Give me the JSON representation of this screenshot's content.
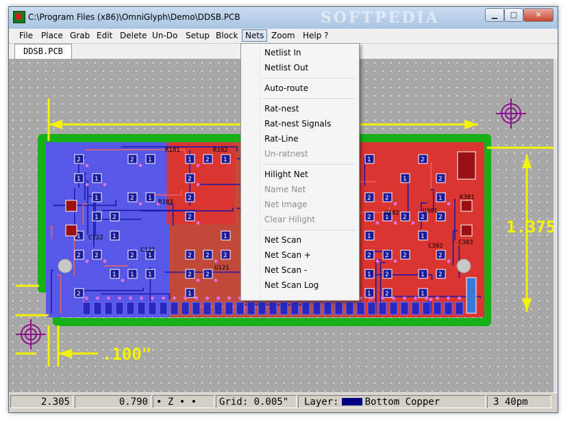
{
  "window": {
    "title": "C:\\Program Files (x86)\\OmniGlyph\\Demo\\DDSB.PCB",
    "watermark": "SOFTPEDIA",
    "controls": {
      "minimize": "▁",
      "maximize": "□",
      "close": "✕"
    }
  },
  "menu": [
    {
      "label": "File"
    },
    {
      "label": "Place"
    },
    {
      "label": "Grab"
    },
    {
      "label": "Edit"
    },
    {
      "label": "Delete"
    },
    {
      "label": "Un-Do"
    },
    {
      "label": "Setup"
    },
    {
      "label": "Block"
    },
    {
      "label": "Nets",
      "active": true
    },
    {
      "label": "Zoom"
    },
    {
      "label": "Help ?"
    }
  ],
  "document_tab": "DDSB.PCB",
  "nets_menu": {
    "items": [
      {
        "label": "Netlist In",
        "enabled": true
      },
      {
        "label": "Netlist Out",
        "enabled": true
      },
      {
        "label": "Auto-route",
        "enabled": true
      },
      {
        "label": "Rat-nest",
        "enabled": true
      },
      {
        "label": "Rat-nest Signals",
        "enabled": true
      },
      {
        "label": "Rat-Line",
        "enabled": true
      },
      {
        "label": "Un-ratnest",
        "enabled": false
      },
      {
        "label": "Hilight Net",
        "enabled": true
      },
      {
        "label": "Name Net",
        "enabled": false
      },
      {
        "label": "Net Image",
        "enabled": false
      },
      {
        "label": "Clear Hilight",
        "enabled": false
      },
      {
        "label": "Net Scan",
        "enabled": true
      },
      {
        "label": "Net Scan +",
        "enabled": true
      },
      {
        "label": "Net Scan -",
        "enabled": true
      },
      {
        "label": "Net Scan Log",
        "enabled": true
      }
    ]
  },
  "board": {
    "dimension_height": "1.375\"",
    "dimension_edge": ".100\"",
    "component_labels": [
      "R101",
      "R102",
      "C121",
      "C122",
      "U121",
      "U302",
      "C302",
      "K301",
      "C303",
      "U301",
      "R103"
    ],
    "colors": {
      "outline": "#17b117",
      "top_copper": "#e03030",
      "bottom_copper": "#1a1aa8",
      "board_blue": "#5858e8",
      "dimension": "#f4f400",
      "target": "#8d0f8d"
    }
  },
  "status": {
    "x": "2.305",
    "y": "0.790",
    "mode": "• Z • •",
    "grid": "Grid: 0.005\"",
    "layer_label": "Layer:",
    "layer_name": "Bottom Copper",
    "layer_color": "#000080",
    "time": "3 40pm"
  }
}
